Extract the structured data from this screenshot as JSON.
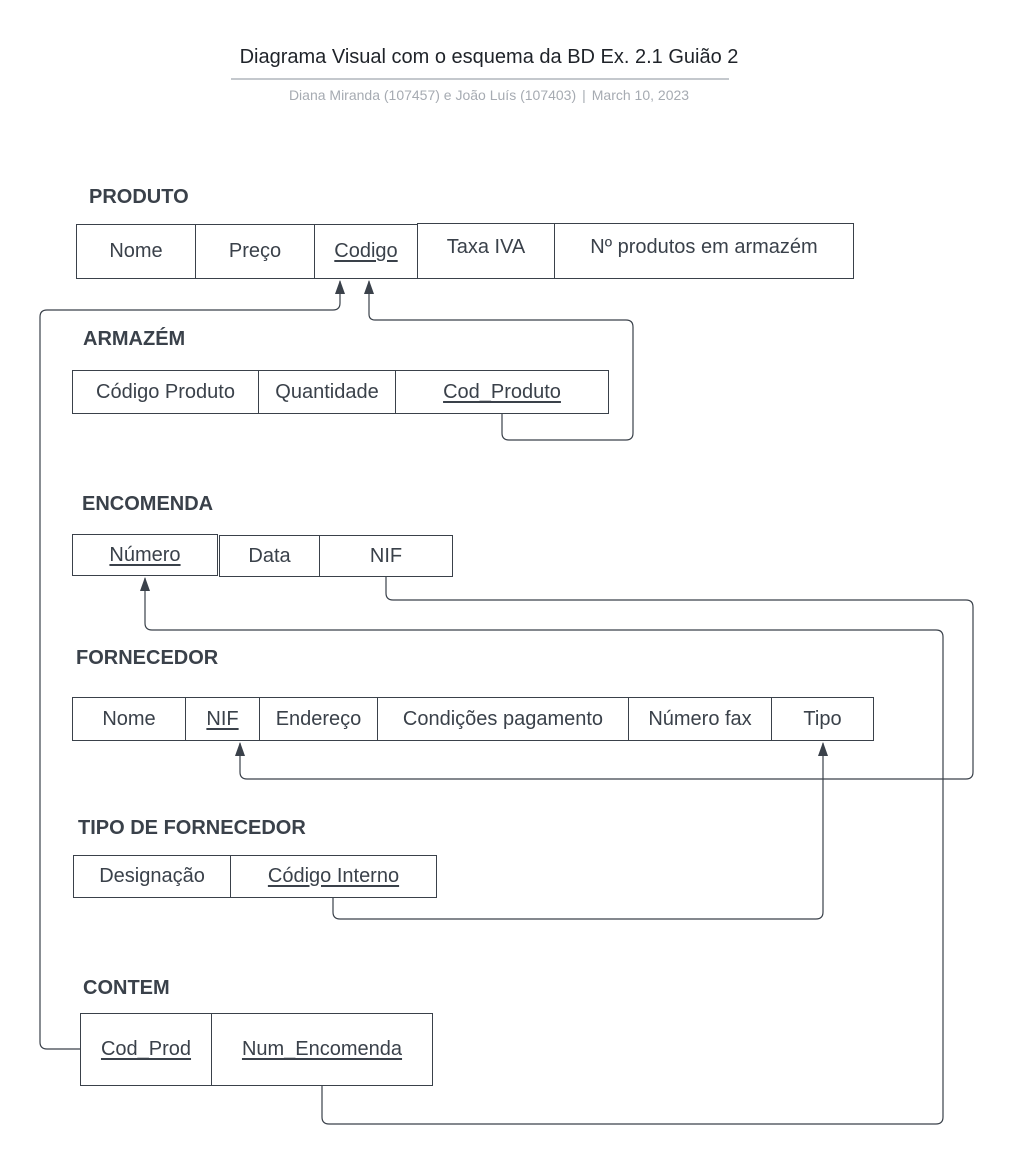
{
  "header": {
    "title": "Diagrama Visual com o esquema da BD Ex. 2.1 Guião 2",
    "authors": "Diana Miranda (107457) e João Luís (107403)",
    "separator": "|",
    "date": "March 10, 2023"
  },
  "tables": {
    "produto": {
      "name": "PRODUTO",
      "fields": [
        "Nome",
        "Preço",
        "Codigo",
        "Taxa IVA",
        "Nº produtos em armazém"
      ]
    },
    "armazem": {
      "name": "ARMAZÉM",
      "fields": [
        "Código Produto",
        "Quantidade",
        "Cod_Produto"
      ]
    },
    "encomenda": {
      "name": "ENCOMENDA",
      "fields": [
        "Número",
        "Data",
        "NIF"
      ]
    },
    "fornecedor": {
      "name": "FORNECEDOR",
      "fields": [
        "Nome",
        "NIF",
        "Endereço",
        "Condições pagamento",
        "Número fax",
        "Tipo"
      ]
    },
    "tipo_fornecedor": {
      "name": "TIPO DE FORNECEDOR",
      "fields": [
        "Designação",
        "Código Interno"
      ]
    },
    "contem": {
      "name": "CONTEM",
      "fields": [
        "Cod_Prod",
        "Num_Encomenda"
      ]
    }
  },
  "colors": {
    "ink": "#3a414a",
    "title": "#1f2329",
    "subtitle": "#a6abb2",
    "rule": "#c4c8cd"
  }
}
